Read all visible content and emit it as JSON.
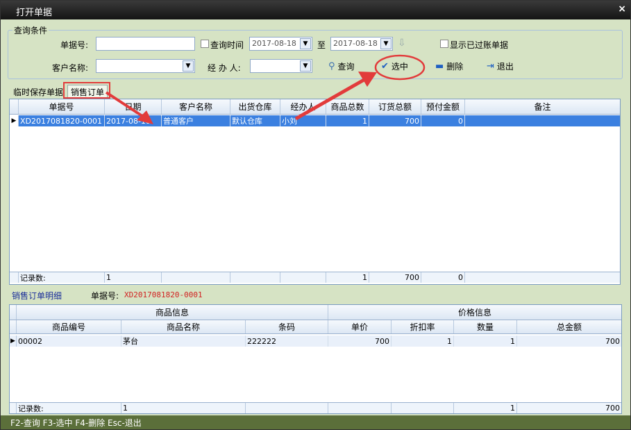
{
  "window": {
    "title": "打开单据",
    "close": "×"
  },
  "query": {
    "legend": "查询条件",
    "order_no_label": "单据号:",
    "order_no_value": "",
    "query_time_label": "查询时间",
    "date_from": "2017-08-18",
    "to_label": "至",
    "date_to": "2017-08-18",
    "show_posted_label": "显示已过账单据",
    "customer_label": "客户名称:",
    "customer_value": "",
    "handler_label": "经 办 人:",
    "handler_value": "",
    "btn_query": "查询",
    "btn_select": "选中",
    "btn_delete": "删除",
    "btn_exit": "退出"
  },
  "tabs": [
    "临时保存单据",
    "销售订单"
  ],
  "orders": {
    "columns": [
      "单据号",
      "日期",
      "客户名称",
      "出货仓库",
      "经办人",
      "商品总数",
      "订货总额",
      "预付金额",
      "备注"
    ],
    "rows": [
      [
        "XD2017081820-0001",
        "2017-08-18",
        "普通客户",
        "默认仓库",
        "小刘",
        "1",
        "700",
        "0",
        ""
      ]
    ],
    "footer": [
      "记录数:",
      "1",
      "",
      "",
      "",
      "1",
      "700",
      "0",
      ""
    ]
  },
  "detail": {
    "title": "销售订单明细",
    "order_no_label": "单据号:",
    "order_no": "XD2017081820-0001",
    "group_headers": [
      "商品信息",
      "价格信息"
    ],
    "columns": [
      "商品编号",
      "商品名称",
      "条码",
      "单价",
      "折扣率",
      "数量",
      "总金额"
    ],
    "rows": [
      [
        "00002",
        "茅台",
        "222222",
        "700",
        "1",
        "1",
        "700"
      ]
    ],
    "footer": [
      "记录数:",
      "1",
      "",
      "",
      "",
      "1",
      "700"
    ]
  },
  "status": "F2-查询 F3-选中 F4-删除 Esc-退出",
  "colors": {
    "accent_annotation": "#e23b3b",
    "selection": "#3b80e0",
    "detail_title": "#1b2f9a",
    "order_no": "#d12020"
  },
  "icons": [
    "close-icon",
    "magnifier-icon",
    "check-icon",
    "minus-icon",
    "exit-icon",
    "down-arrow-icon",
    "row-pointer-icon"
  ]
}
